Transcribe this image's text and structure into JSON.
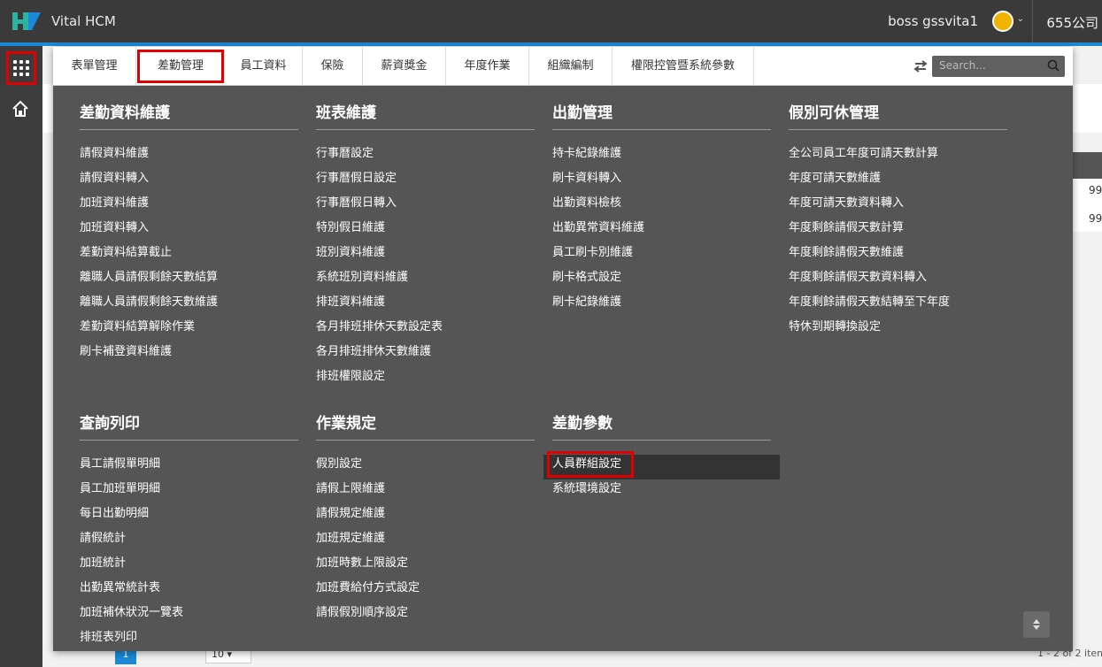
{
  "app": {
    "title": "Vital HCM"
  },
  "user": {
    "name": "boss gssvita1",
    "company": "655公司"
  },
  "search": {
    "placeholder": "Search..."
  },
  "tabs": [
    "表單管理",
    "差勤管理",
    "員工資料",
    "保險",
    "薪資獎金",
    "年度作業",
    "組織編制",
    "權限控管暨系統參數"
  ],
  "active_tab": "差勤管理",
  "menu": {
    "col1": {
      "title": "差勤資料維護",
      "items": [
        "請假資料維護",
        "請假資料轉入",
        "加班資料維護",
        "加班資料轉入",
        "差勤資料結算截止",
        "離職人員請假剩餘天數結算",
        "離職人員請假剩餘天數維護",
        "差勤資料結算解除作業",
        "刷卡補登資料維護"
      ]
    },
    "col2": {
      "title": "班表維護",
      "items": [
        "行事曆設定",
        "行事曆假日設定",
        "行事曆假日轉入",
        "特別假日維護",
        "班別資料維護",
        "系統班別資料維護",
        "排班資料維護",
        "各月排班排休天數設定表",
        "各月排班排休天數維護",
        "排班權限設定"
      ]
    },
    "col3": {
      "title": "出勤管理",
      "items": [
        "持卡紀錄維護",
        "刷卡資料轉入",
        "出勤資料檢核",
        "出勤異常資料維護",
        "員工刷卡別維護",
        "刷卡格式設定",
        "刷卡紀錄維護"
      ]
    },
    "col4": {
      "title": "假別可休管理",
      "items": [
        "全公司員工年度可請天數計算",
        "年度可請天數維護",
        "年度可請天數資料轉入",
        "年度剩餘請假天數計算",
        "年度剩餘請假天數維護",
        "年度剩餘請假天數資料轉入",
        "年度剩餘請假天數結轉至下年度",
        "特休到期轉換設定"
      ]
    },
    "col5": {
      "title": "查詢列印",
      "items": [
        "員工請假單明細",
        "員工加班單明細",
        "每日出勤明細",
        "請假統計",
        "加班統計",
        "出勤異常統計表",
        "加班補休狀況一覽表",
        "排班表列印"
      ]
    },
    "col6": {
      "title": "作業規定",
      "items": [
        "假別設定",
        "請假上限維護",
        "請假規定維護",
        "加班規定維護",
        "加班時數上限設定",
        "加班費給付方式設定",
        "請假假別順序設定"
      ]
    },
    "col7": {
      "title": "差勤參數",
      "items": [
        "人員群組設定",
        "系統環境設定"
      ]
    }
  },
  "background": {
    "cells": [
      "99",
      "99"
    ],
    "page_size": "10",
    "page_num": "1",
    "footer": "1 - 2 of 2 item"
  }
}
